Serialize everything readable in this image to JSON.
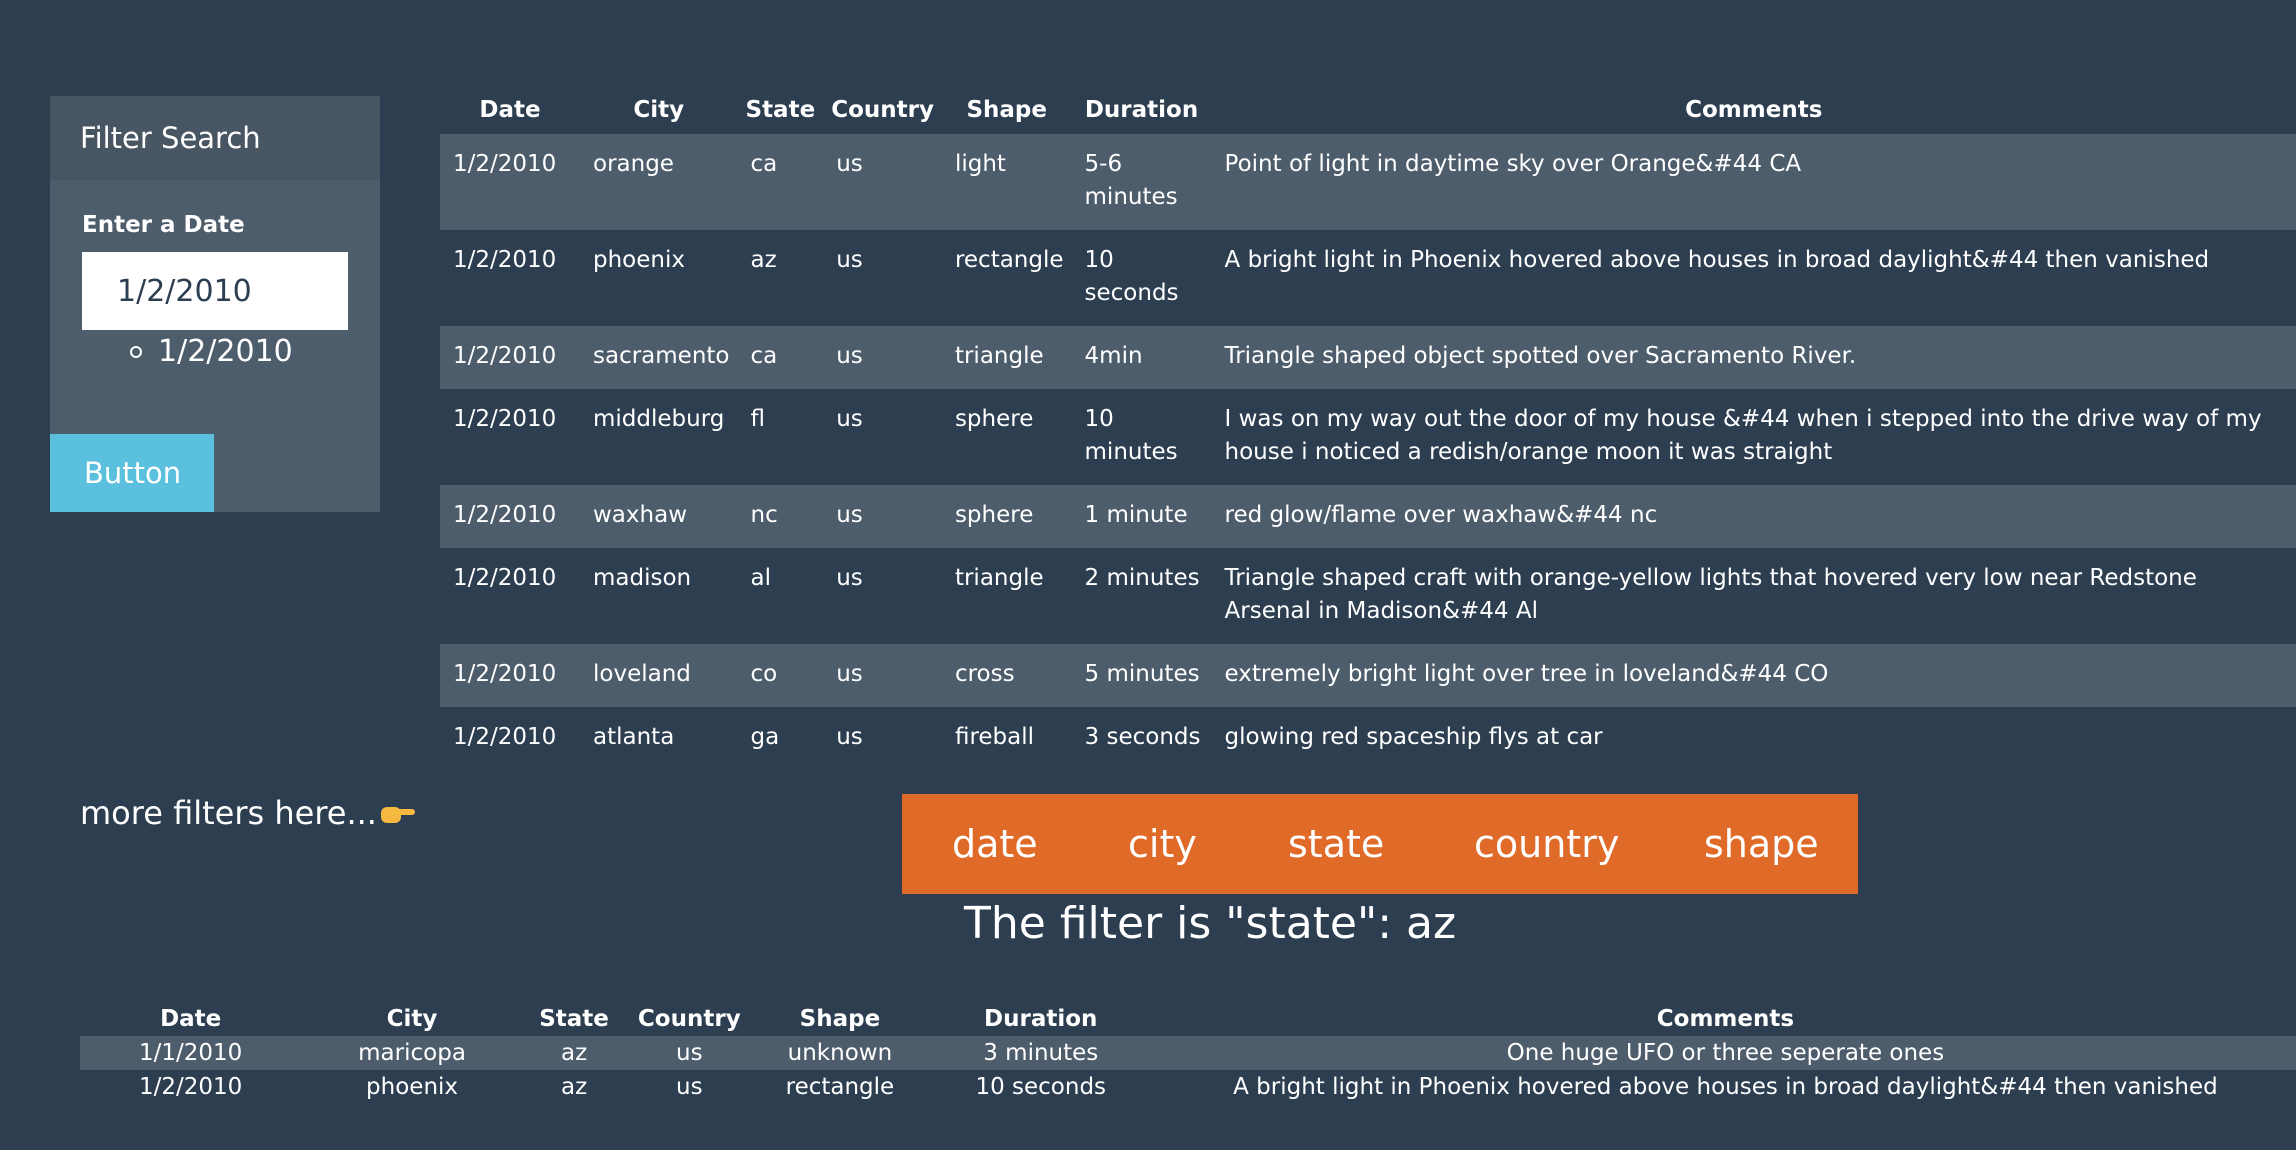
{
  "panel": {
    "title": "Filter Search",
    "label": "Enter a Date",
    "input_value": "1/2/2010",
    "suggestion": "1/2/2010",
    "button_label": "Button"
  },
  "main_table": {
    "headers": [
      "Date",
      "City",
      "State",
      "Country",
      "Shape",
      "Duration",
      "Comments"
    ],
    "rows": [
      [
        "1/2/2010",
        "orange",
        "ca",
        "us",
        "light",
        "5-6 minutes",
        "Point of light in daytime sky over Orange&#44 CA"
      ],
      [
        "1/2/2010",
        "phoenix",
        "az",
        "us",
        "rectangle",
        "10 seconds",
        "A bright light in Phoenix hovered above houses in broad daylight&#44 then vanished"
      ],
      [
        "1/2/2010",
        "sacramento",
        "ca",
        "us",
        "triangle",
        "4min",
        "Triangle shaped object spotted over Sacramento River."
      ],
      [
        "1/2/2010",
        "middleburg",
        "fl",
        "us",
        "sphere",
        "10 minutes",
        "I was on my way out the door of my house &#44 when i stepped into the drive way of my house i noticed a redish/orange moon it was straight"
      ],
      [
        "1/2/2010",
        "waxhaw",
        "nc",
        "us",
        "sphere",
        "1 minute",
        "red glow/flame over waxhaw&#44 nc"
      ],
      [
        "1/2/2010",
        "madison",
        "al",
        "us",
        "triangle",
        "2 minutes",
        "Triangle shaped craft with orange-yellow lights that hovered very low near Redstone Arsenal in Madison&#44 Al"
      ],
      [
        "1/2/2010",
        "loveland",
        "co",
        "us",
        "cross",
        "5 minutes",
        "extremely bright light over tree in loveland&#44 CO"
      ],
      [
        "1/2/2010",
        "atlanta",
        "ga",
        "us",
        "fireball",
        "3 seconds",
        "glowing red spaceship flys at car"
      ]
    ]
  },
  "more_filters": {
    "text": "more filters here...",
    "icon": "pointing-right-hand-icon"
  },
  "filter_bar": {
    "date": "date",
    "city": "city",
    "state": "state",
    "country": "country",
    "shape": "shape"
  },
  "filter_status": "The filter is \"state\": az",
  "result_table": {
    "headers": [
      "Date",
      "City",
      "State",
      "Country",
      "Shape",
      "Duration",
      "Comments"
    ],
    "rows": [
      [
        "1/1/2010",
        "maricopa",
        "az",
        "us",
        "unknown",
        "3 minutes",
        "One huge UFO or three seperate ones"
      ],
      [
        "1/2/2010",
        "phoenix",
        "az",
        "us",
        "rectangle",
        "10 seconds",
        "A bright light in Phoenix hovered above houses in broad daylight&#44 then vanished"
      ]
    ]
  },
  "colors": {
    "background": "#2c3e50",
    "panel": "#4e5d6c",
    "button": "#5bc0de",
    "filter_bar": "#e06a28"
  }
}
